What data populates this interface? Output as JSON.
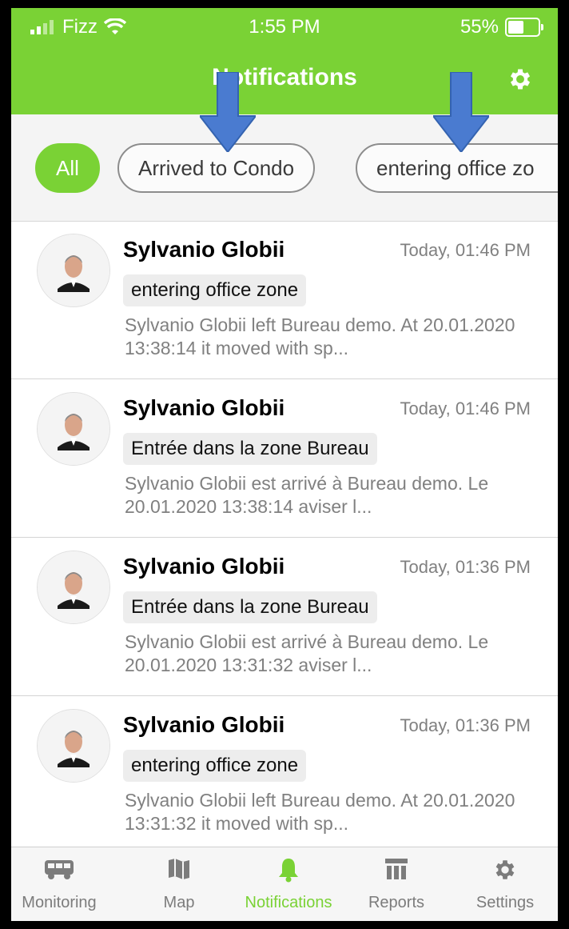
{
  "status_bar": {
    "carrier": "Fizz",
    "time": "1:55 PM",
    "battery": "55%",
    "battery_level": 0.55
  },
  "header": {
    "title": "Notifications",
    "settings_icon": "gear-icon"
  },
  "filters": [
    {
      "label": "All",
      "active": true
    },
    {
      "label": "Arrived to Condo",
      "active": false
    },
    {
      "label": "entering office zo",
      "active": false
    }
  ],
  "notifications": [
    {
      "name": "Sylvanio Globii",
      "time": "Today, 01:46 PM",
      "tag": "entering office zone",
      "body": "Sylvanio Globii left Bureau demo. At 20.01.2020 13:38:14 it moved with sp..."
    },
    {
      "name": "Sylvanio Globii",
      "time": "Today, 01:46 PM",
      "tag": "Entrée dans la zone Bureau",
      "body": "Sylvanio Globii est arrivé à Bureau demo. Le 20.01.2020 13:38:14  aviser l..."
    },
    {
      "name": "Sylvanio Globii",
      "time": "Today, 01:36 PM",
      "tag": "Entrée dans la zone Bureau",
      "body": "Sylvanio Globii est arrivé à Bureau demo. Le 20.01.2020 13:31:32  aviser l..."
    },
    {
      "name": "Sylvanio Globii",
      "time": "Today, 01:36 PM",
      "tag": "entering office zone",
      "body": "Sylvanio Globii left Bureau demo. At 20.01.2020 13:31:32 it moved with sp..."
    }
  ],
  "tabbar": {
    "monitoring": "Monitoring",
    "map": "Map",
    "notifications": "Notifications",
    "reports": "Reports",
    "settings": "Settings",
    "active": "notifications"
  },
  "colors": {
    "accent": "#7ad235",
    "arrow": "#4a7bd0"
  }
}
